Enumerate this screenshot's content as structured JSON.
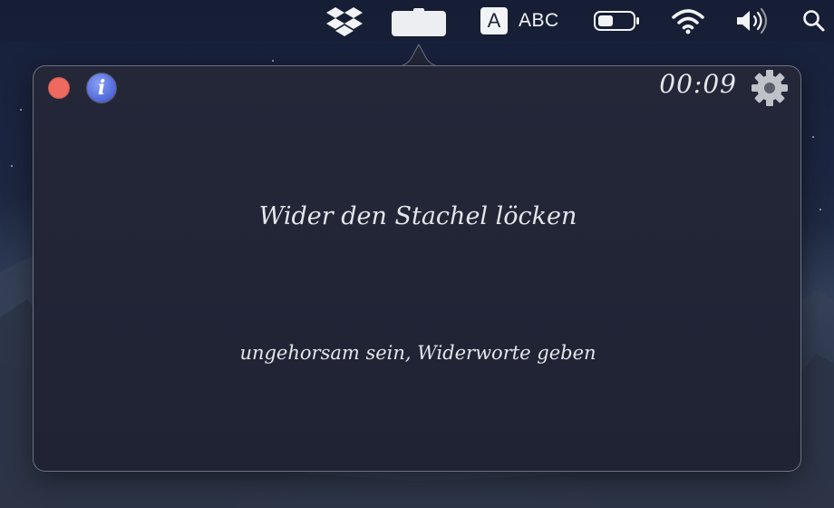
{
  "menubar": {
    "items": [
      {
        "icon": "dropbox-icon"
      },
      {
        "icon": "app-menu-icon",
        "active": true
      },
      {
        "icon": "input-source-icon",
        "glyph": "A",
        "label": "ABC"
      },
      {
        "icon": "battery-icon"
      },
      {
        "icon": "wifi-icon"
      },
      {
        "icon": "volume-icon"
      },
      {
        "icon": "spotlight-search-icon"
      }
    ]
  },
  "popover": {
    "close_icon": "close-icon",
    "info_glyph": "i",
    "timer": "00:09",
    "settings_icon": "gear-icon",
    "phrase": "Wider den Stachel löcken",
    "meaning": "ungehorsam sein, Widerworte geben"
  },
  "colors": {
    "close": "#ee6a5f",
    "info": "#5a72e0",
    "text": "#e4e6ea",
    "popover_bg": "#222637",
    "menubar_bg": "#161e34"
  }
}
